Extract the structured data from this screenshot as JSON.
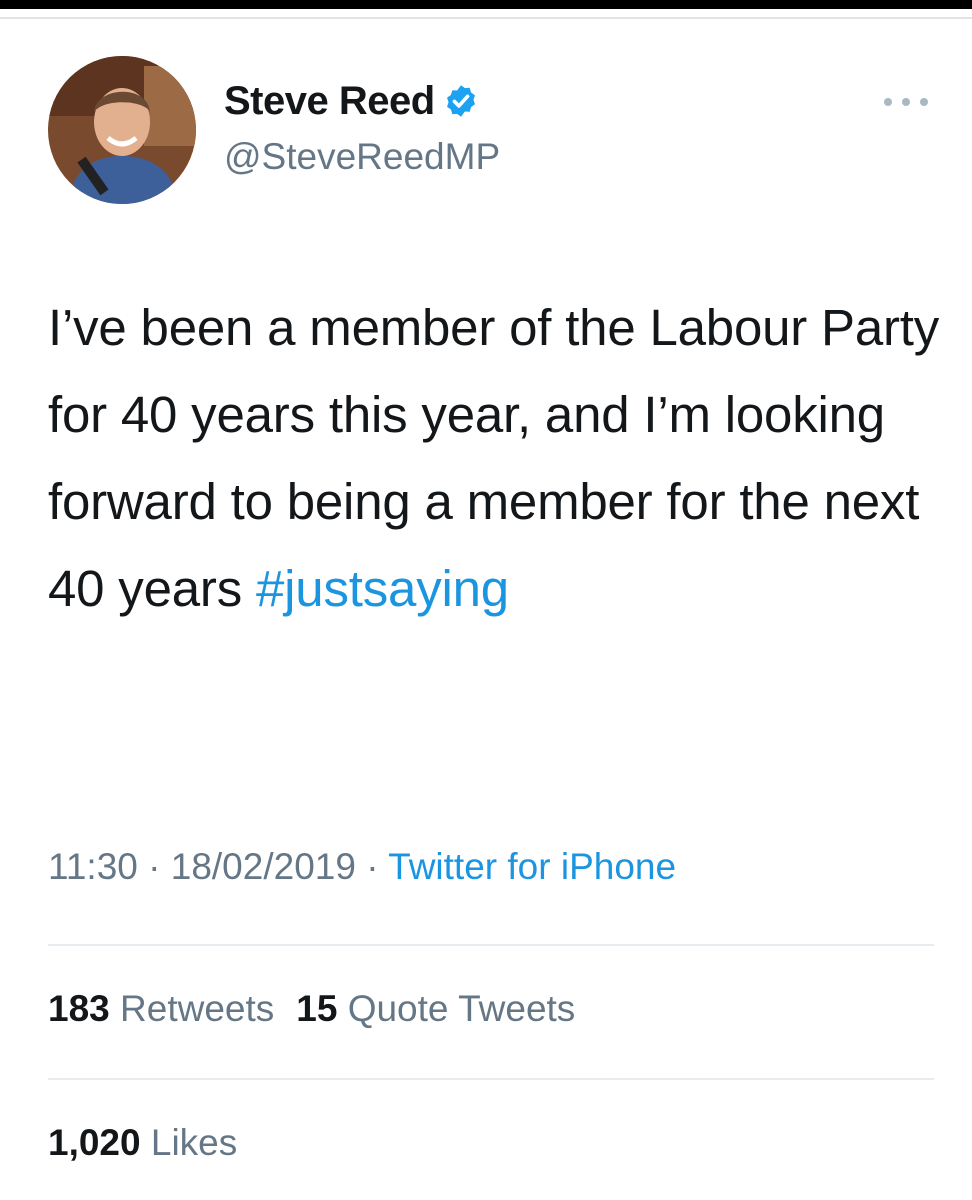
{
  "user": {
    "display_name": "Steve Reed",
    "handle": "@SteveReedMP",
    "verified": true
  },
  "tweet": {
    "text": "I’ve been a member of the Labour Party for 40 years this year, and I’m looking forward to being a member for the next 40 years",
    "hashtag": "#justsaying",
    "time": "11:30",
    "date": "18/02/2019",
    "source": "Twitter for iPhone",
    "separator": " · "
  },
  "stats": {
    "retweets_count": "183",
    "retweets_label": "Retweets",
    "quotes_count": "15",
    "quotes_label": "Quote Tweets",
    "likes_count": "1,020",
    "likes_label": "Likes"
  },
  "icons": {
    "verified": "verified-badge-icon",
    "more": "more-options-icon"
  },
  "colors": {
    "link": "#1b95e0",
    "secondary": "#657786",
    "verified": "#1da1f2"
  }
}
